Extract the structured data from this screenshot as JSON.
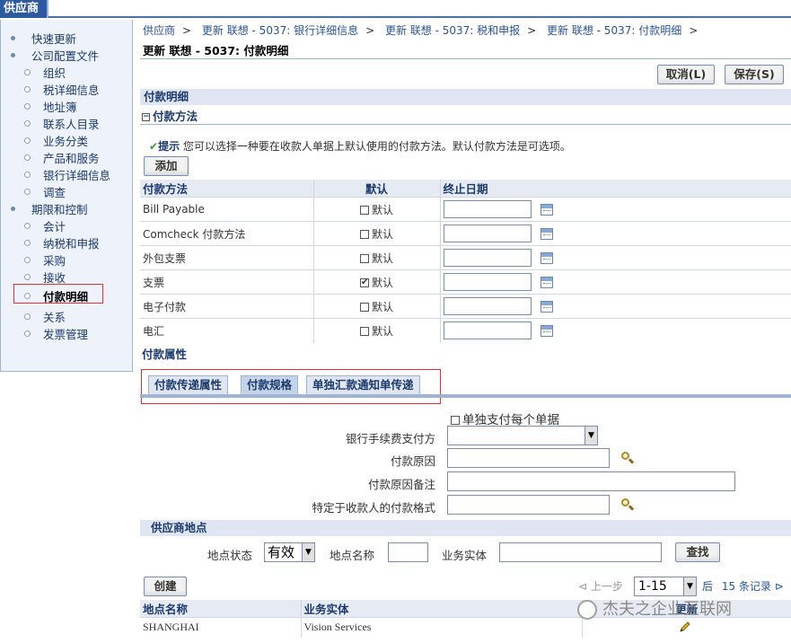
{
  "top_tab": "供应商",
  "sidebar": {
    "items": [
      {
        "label": "快速更新",
        "level": 0
      },
      {
        "label": "公司配置文件",
        "level": 0
      },
      {
        "label": "组织",
        "level": 1
      },
      {
        "label": "税详细信息",
        "level": 1
      },
      {
        "label": "地址簿",
        "level": 1
      },
      {
        "label": "联系人目录",
        "level": 1
      },
      {
        "label": "业务分类",
        "level": 1
      },
      {
        "label": "产品和服务",
        "level": 1
      },
      {
        "label": "银行详细信息",
        "level": 1
      },
      {
        "label": "调查",
        "level": 1
      },
      {
        "label": "期限和控制",
        "level": 0
      },
      {
        "label": "会计",
        "level": 1
      },
      {
        "label": "纳税和申报",
        "level": 1
      },
      {
        "label": "采购",
        "level": 1
      },
      {
        "label": "接收",
        "level": 1
      },
      {
        "label": "付款明细",
        "level": 1,
        "active": true
      },
      {
        "label": "关系",
        "level": 1
      },
      {
        "label": "发票管理",
        "level": 1
      }
    ]
  },
  "breadcrumbs": [
    "供应商",
    "更新  联想  - 5037: 银行详细信息",
    "更新  联想  - 5037: 税和申报",
    "更新  联想  - 5037: 付款明细"
  ],
  "breadcrumb_trailing": ">",
  "page_title": "更新  联想  - 5037: 付款明细",
  "buttons": {
    "cancel": "取消(L)",
    "save": "保存(S)",
    "add": "添加",
    "find": "查找",
    "create": "创建"
  },
  "section_payment_details": "付款明细",
  "subsection_payment_method": "付款方法",
  "tip": {
    "label": "提示",
    "text": " 您可以选择一种要在收款人单据上默认使用的付款方法。默认付款方法是可选项。"
  },
  "methods_table": {
    "headers": [
      "付款方法",
      "默认",
      "终止日期"
    ],
    "default_label": "默认",
    "rows": [
      {
        "method": "Bill Payable",
        "checked": false
      },
      {
        "method": "Comcheck 付款方法",
        "checked": false
      },
      {
        "method": "外包支票",
        "checked": false
      },
      {
        "method": "支票",
        "checked": true
      },
      {
        "method": "电子付款",
        "checked": false
      },
      {
        "method": "电汇",
        "checked": false
      }
    ]
  },
  "payment_attributes": "付款属性",
  "subtabs": [
    "付款传递属性",
    "付款规格",
    "单独汇款通知单传递"
  ],
  "active_subtab": 1,
  "form": {
    "pay_each_doc": "单独支付每个单据",
    "bank_charge": "银行手续费支付方",
    "reason": "付款原因",
    "reason_note": "付款原因备注",
    "payee_format": "特定于收款人的付款格式"
  },
  "supplier_sites": {
    "title": "供应商地点",
    "status_label": "地点状态",
    "status_value": "有效",
    "name_label": "地点名称",
    "entity_label": "业务实体",
    "pager": {
      "prev": "上一步",
      "range": "1-15",
      "next": "后",
      "count": "15 条记录"
    },
    "headers": [
      "地点名称",
      "业务实体",
      "更新"
    ],
    "rows": [
      {
        "name": "SHANGHAI",
        "entity": "Vision Services"
      }
    ]
  },
  "watermark": "杰夫之企业互联网"
}
